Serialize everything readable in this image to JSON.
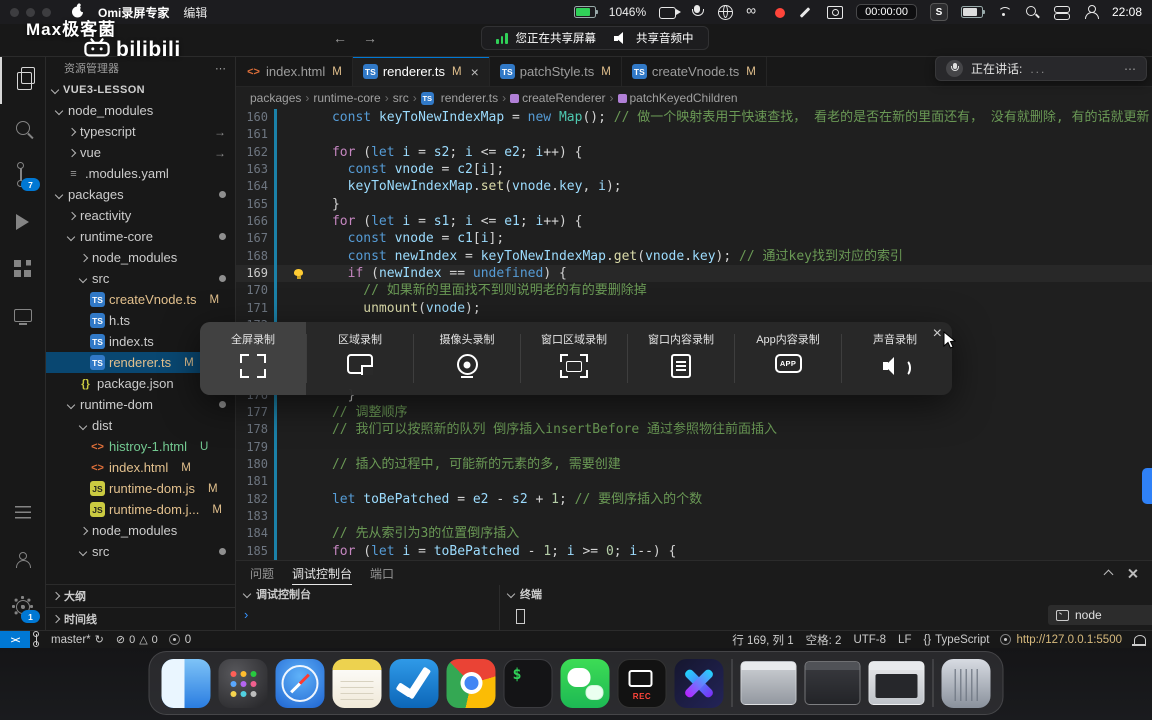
{
  "icon_glyphs": {
    "ts": "TS",
    "js": "JS",
    "html": "<>",
    "json": "{}",
    "yaml": "≡",
    "link": "→",
    "close": "×"
  },
  "menubar": {
    "app_name": "Omi录屏专家",
    "menu_edit": "编辑",
    "battery_pct": "1046%",
    "record_timer": "00:00:00",
    "s_badge": "S",
    "clock": "22:08"
  },
  "overlays": {
    "watermark_line1": "Max极客菌",
    "watermark_brand": "bilibili",
    "share_screen": "您正在共享屏幕",
    "share_audio": "共享音频中",
    "speaking_label": "正在讲话:",
    "speaking_dots": "...",
    "speaking_more": "⋯"
  },
  "titlebar": {
    "back": "←",
    "forward": "→"
  },
  "record_toolbar": {
    "close": "×",
    "items": [
      {
        "label": "全屏录制",
        "active": true
      },
      {
        "label": "区域录制"
      },
      {
        "label": "摄像头录制"
      },
      {
        "label": "窗口区域录制"
      },
      {
        "label": "窗口内容录制"
      },
      {
        "label": "App内容录制",
        "icon_text": "APP"
      },
      {
        "label": "声音录制"
      }
    ]
  },
  "tabs": [
    {
      "label": "index.html",
      "icon": "html",
      "badge": "M",
      "active": false
    },
    {
      "label": "renderer.ts",
      "icon": "ts",
      "badge": "M",
      "active": true
    },
    {
      "label": "patchStyle.ts",
      "icon": "ts",
      "badge": "M",
      "active": false
    },
    {
      "label": "createVnode.ts",
      "icon": "ts",
      "badge": "M",
      "active": false
    }
  ],
  "breadcrumb": [
    {
      "label": "packages"
    },
    {
      "label": "runtime-core"
    },
    {
      "label": "src"
    },
    {
      "label": "renderer.ts",
      "icon": "ts"
    },
    {
      "label": "createRenderer",
      "icon": "method"
    },
    {
      "label": "patchKeyedChildren",
      "icon": "method"
    }
  ],
  "explorer": {
    "title": "资源管理器",
    "root": "VUE3-LESSON",
    "tree": [
      {
        "label": "node_modules",
        "type": "folder",
        "expanded": true,
        "indent": 0
      },
      {
        "label": "typescript",
        "type": "folder",
        "indent": 1,
        "link": true
      },
      {
        "label": "vue",
        "type": "folder",
        "indent": 1,
        "link": true
      },
      {
        "label": ".modules.yaml",
        "type": "file",
        "icon": "yaml",
        "indent": 1
      },
      {
        "label": "packages",
        "type": "folder",
        "expanded": true,
        "indent": 0,
        "dot": true
      },
      {
        "label": "reactivity",
        "type": "folder",
        "indent": 1
      },
      {
        "label": "runtime-core",
        "type": "folder",
        "expanded": true,
        "indent": 1,
        "dot": true
      },
      {
        "label": "node_modules",
        "type": "folder",
        "indent": 2
      },
      {
        "label": "src",
        "type": "folder",
        "expanded": true,
        "indent": 2,
        "dot": true
      },
      {
        "label": "createVnode.ts",
        "type": "file",
        "icon": "ts",
        "indent": 3,
        "badge": "M"
      },
      {
        "label": "h.ts",
        "type": "file",
        "icon": "ts",
        "indent": 3
      },
      {
        "label": "index.ts",
        "type": "file",
        "icon": "ts",
        "indent": 3
      },
      {
        "label": "renderer.ts",
        "type": "file",
        "icon": "ts",
        "indent": 3,
        "badge": "M",
        "selected": true
      },
      {
        "label": "package.json",
        "type": "file",
        "icon": "json",
        "indent": 2
      },
      {
        "label": "runtime-dom",
        "type": "folder",
        "expanded": true,
        "indent": 1,
        "dot": true
      },
      {
        "label": "dist",
        "type": "folder",
        "expanded": true,
        "indent": 2
      },
      {
        "label": "histroy-1.html",
        "type": "file",
        "icon": "html",
        "indent": 3,
        "badge": "U"
      },
      {
        "label": "index.html",
        "type": "file",
        "icon": "html",
        "indent": 3,
        "badge": "M"
      },
      {
        "label": "runtime-dom.js",
        "type": "file",
        "icon": "js",
        "indent": 3,
        "badge": "M"
      },
      {
        "label": "runtime-dom.j...",
        "type": "file",
        "icon": "js",
        "indent": 3,
        "badge": "M"
      },
      {
        "label": "node_modules",
        "type": "folder",
        "indent": 2
      },
      {
        "label": "src",
        "type": "folder",
        "expanded": true,
        "indent": 2,
        "dot": true
      }
    ],
    "sections": [
      "大纲",
      "时间线"
    ]
  },
  "editor": {
    "active_line": 169,
    "lines": [
      {
        "num": 160,
        "tokens": [
          [
            "p",
            "      "
          ],
          [
            "k",
            "const"
          ],
          [
            "p",
            " "
          ],
          [
            "v",
            "keyToNewIndexMap"
          ],
          [
            "p",
            " = "
          ],
          [
            "k",
            "new"
          ],
          [
            "p",
            " "
          ],
          [
            "t",
            "Map"
          ],
          [
            "p",
            "(); "
          ],
          [
            "m",
            "// 做一个映射表用于快速查找， 看老的是否在新的里面还有， 没有就删除, 有的话就更新"
          ]
        ]
      },
      {
        "num": 161,
        "tokens": []
      },
      {
        "num": 162,
        "tokens": [
          [
            "p",
            "      "
          ],
          [
            "c",
            "for"
          ],
          [
            "p",
            " ("
          ],
          [
            "k",
            "let"
          ],
          [
            "p",
            " "
          ],
          [
            "v",
            "i"
          ],
          [
            "p",
            " = "
          ],
          [
            "v",
            "s2"
          ],
          [
            "p",
            "; "
          ],
          [
            "v",
            "i"
          ],
          [
            "p",
            " <= "
          ],
          [
            "v",
            "e2"
          ],
          [
            "p",
            "; "
          ],
          [
            "v",
            "i"
          ],
          [
            "p",
            "++) {"
          ]
        ]
      },
      {
        "num": 163,
        "tokens": [
          [
            "p",
            "        "
          ],
          [
            "k",
            "const"
          ],
          [
            "p",
            " "
          ],
          [
            "v",
            "vnode"
          ],
          [
            "p",
            " = "
          ],
          [
            "v",
            "c2"
          ],
          [
            "p",
            "["
          ],
          [
            "v",
            "i"
          ],
          [
            "p",
            "];"
          ]
        ]
      },
      {
        "num": 164,
        "tokens": [
          [
            "p",
            "        "
          ],
          [
            "v",
            "keyToNewIndexMap"
          ],
          [
            "p",
            "."
          ],
          [
            "f",
            "set"
          ],
          [
            "p",
            "("
          ],
          [
            "v",
            "vnode"
          ],
          [
            "p",
            "."
          ],
          [
            "v",
            "key"
          ],
          [
            "p",
            ", "
          ],
          [
            "v",
            "i"
          ],
          [
            "p",
            ");"
          ]
        ]
      },
      {
        "num": 165,
        "tokens": [
          [
            "p",
            "      }"
          ]
        ]
      },
      {
        "num": 166,
        "tokens": [
          [
            "p",
            "      "
          ],
          [
            "c",
            "for"
          ],
          [
            "p",
            " ("
          ],
          [
            "k",
            "let"
          ],
          [
            "p",
            " "
          ],
          [
            "v",
            "i"
          ],
          [
            "p",
            " = "
          ],
          [
            "v",
            "s1"
          ],
          [
            "p",
            "; "
          ],
          [
            "v",
            "i"
          ],
          [
            "p",
            " <= "
          ],
          [
            "v",
            "e1"
          ],
          [
            "p",
            "; "
          ],
          [
            "v",
            "i"
          ],
          [
            "p",
            "++) {"
          ]
        ]
      },
      {
        "num": 167,
        "tokens": [
          [
            "p",
            "        "
          ],
          [
            "k",
            "const"
          ],
          [
            "p",
            " "
          ],
          [
            "v",
            "vnode"
          ],
          [
            "p",
            " = "
          ],
          [
            "v",
            "c1"
          ],
          [
            "p",
            "["
          ],
          [
            "v",
            "i"
          ],
          [
            "p",
            "];"
          ]
        ]
      },
      {
        "num": 168,
        "tokens": [
          [
            "p",
            "        "
          ],
          [
            "k",
            "const"
          ],
          [
            "p",
            " "
          ],
          [
            "v",
            "newIndex"
          ],
          [
            "p",
            " = "
          ],
          [
            "v",
            "keyToNewIndexMap"
          ],
          [
            "p",
            "."
          ],
          [
            "f",
            "get"
          ],
          [
            "p",
            "("
          ],
          [
            "v",
            "vnode"
          ],
          [
            "p",
            "."
          ],
          [
            "v",
            "key"
          ],
          [
            "p",
            "); "
          ],
          [
            "m",
            "// 通过key找到对应的索引"
          ]
        ]
      },
      {
        "num": 169,
        "tokens": [
          [
            "p",
            "        "
          ],
          [
            "c",
            "if"
          ],
          [
            "p",
            " ("
          ],
          [
            "v",
            "newIndex"
          ],
          [
            "p",
            " == "
          ],
          [
            "k",
            "undefined"
          ],
          [
            "p",
            ") {"
          ]
        ]
      },
      {
        "num": 170,
        "tokens": [
          [
            "p",
            "          "
          ],
          [
            "m",
            "// 如果新的里面找不到则说明老的有的要删除掉"
          ]
        ]
      },
      {
        "num": 171,
        "tokens": [
          [
            "p",
            "          "
          ],
          [
            "f",
            "unmount"
          ],
          [
            "p",
            "("
          ],
          [
            "v",
            "vnode"
          ],
          [
            "p",
            ");"
          ]
        ]
      },
      {
        "num": 172,
        "tokens": []
      },
      {
        "num": 173,
        "tokens": []
      },
      {
        "num": 174,
        "tokens": []
      },
      {
        "num": 175,
        "tokens": []
      },
      {
        "num": 176,
        "tokens": [
          [
            "p",
            "        }"
          ]
        ]
      },
      {
        "num": 177,
        "tokens": [
          [
            "p",
            "      "
          ],
          [
            "m",
            "// 调整顺序"
          ]
        ]
      },
      {
        "num": 178,
        "tokens": [
          [
            "p",
            "      "
          ],
          [
            "m",
            "// 我们可以按照新的队列 倒序插入insertBefore 通过参照物往前面插入"
          ]
        ]
      },
      {
        "num": 179,
        "tokens": []
      },
      {
        "num": 180,
        "tokens": [
          [
            "p",
            "      "
          ],
          [
            "m",
            "// 插入的过程中, 可能新的元素的多, 需要创建"
          ]
        ]
      },
      {
        "num": 181,
        "tokens": []
      },
      {
        "num": 182,
        "tokens": [
          [
            "p",
            "      "
          ],
          [
            "k",
            "let"
          ],
          [
            "p",
            " "
          ],
          [
            "v",
            "toBePatched"
          ],
          [
            "p",
            " = "
          ],
          [
            "v",
            "e2"
          ],
          [
            "p",
            " - "
          ],
          [
            "v",
            "s2"
          ],
          [
            "p",
            " + "
          ],
          [
            "n",
            "1"
          ],
          [
            "p",
            "; "
          ],
          [
            "m",
            "// 要倒序插入的个数"
          ]
        ]
      },
      {
        "num": 183,
        "tokens": []
      },
      {
        "num": 184,
        "tokens": [
          [
            "p",
            "      "
          ],
          [
            "m",
            "// 先从索引为3的位置倒序插入"
          ]
        ]
      },
      {
        "num": 185,
        "tokens": [
          [
            "p",
            "      "
          ],
          [
            "c",
            "for"
          ],
          [
            "p",
            " ("
          ],
          [
            "k",
            "let"
          ],
          [
            "p",
            " "
          ],
          [
            "v",
            "i"
          ],
          [
            "p",
            " = "
          ],
          [
            "v",
            "toBePatched"
          ],
          [
            "p",
            " - "
          ],
          [
            "n",
            "1"
          ],
          [
            "p",
            "; "
          ],
          [
            "v",
            "i"
          ],
          [
            "p",
            " >= "
          ],
          [
            "n",
            "0"
          ],
          [
            "p",
            "; "
          ],
          [
            "v",
            "i"
          ],
          [
            "p",
            "--) {"
          ]
        ]
      }
    ]
  },
  "panel": {
    "tabs": [
      {
        "label": "问题",
        "active": false
      },
      {
        "label": "调试控制台",
        "active": true
      },
      {
        "label": "端口",
        "active": false
      }
    ],
    "console_header": "调试控制台",
    "terminal_header": "终端",
    "console_prompt": "›",
    "terminal_items": [
      {
        "label": "node"
      }
    ]
  },
  "statusbar": {
    "remote": "><",
    "branch": "master*",
    "sync": "↻",
    "errors": "0",
    "warnings": "0",
    "extra": "0",
    "line_col": "行 169, 列 1",
    "spaces": "空格: 2",
    "encoding": "UTF-8",
    "eol": "LF",
    "lang_braces": "{}",
    "language": "TypeScript",
    "url": "http://127.0.0.1:5500"
  },
  "activity_bar": {
    "scm_badge": "7",
    "settings_badge": "1"
  },
  "dock": {
    "items": [
      "finder",
      "launchpad",
      "safari",
      "notes",
      "vscode",
      "chrome",
      "terminal",
      "wechat",
      "screen-recorder",
      "video-editor",
      "window-preview-1",
      "window-preview-2",
      "window-preview-3",
      "trash"
    ]
  },
  "colors": {
    "accent_blue": "#0078d4",
    "modified_badge": "#e2c08d",
    "untracked_badge": "#73c991",
    "url_orange": "#d7ba7d"
  }
}
